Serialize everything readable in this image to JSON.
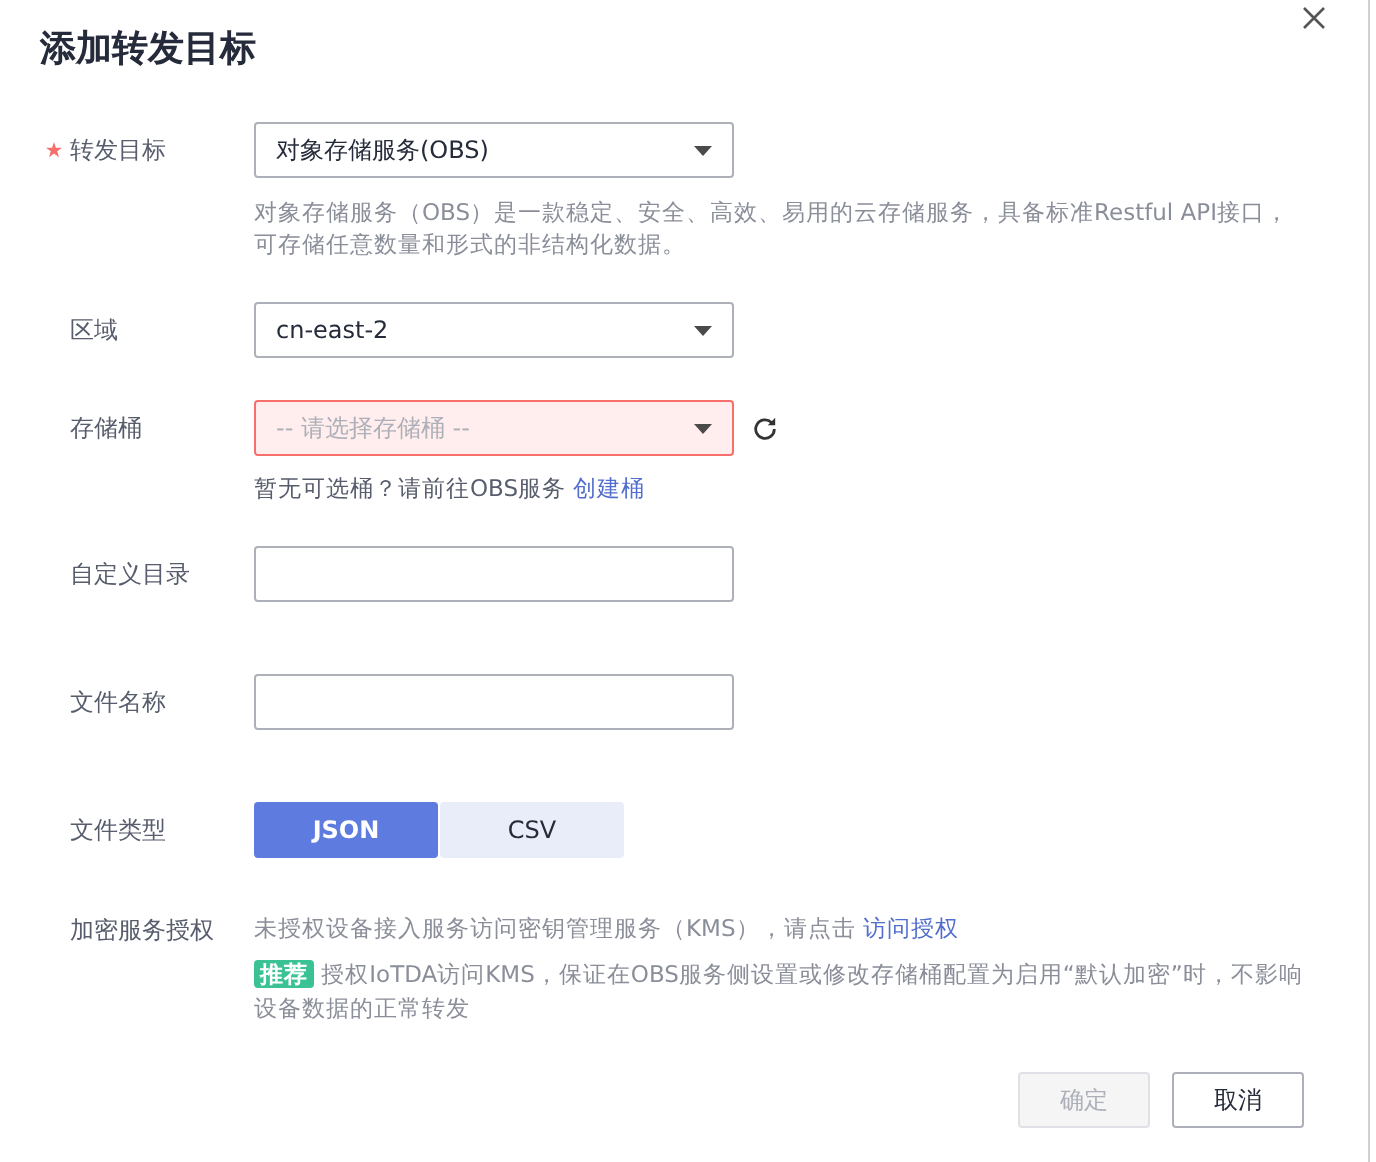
{
  "title": "添加转发目标",
  "fields": [
    {
      "kind": "select",
      "label": "转发目标",
      "required": true,
      "value": "对象存储服务(OBS)",
      "error": false,
      "help": "对象存储服务（OBS）是一款稳定、安全、高效、易用的云存储服务，具备标准Restful API接口，可存储任意数量和形式的非结构化数据。"
    },
    {
      "kind": "select",
      "label": "区域",
      "required": false,
      "value": "cn-east-2",
      "error": false
    },
    {
      "kind": "select",
      "label": "存储桶",
      "required": false,
      "placeholder": "-- 请选择存储桶 --",
      "error": true,
      "refresh": true,
      "hint": "暂无可选桶？请前往OBS服务",
      "hint_link": "创建桶"
    },
    {
      "kind": "input",
      "label": "自定义目录",
      "required": false
    },
    {
      "kind": "input",
      "label": "文件名称",
      "required": false
    },
    {
      "kind": "toggle",
      "label": "文件类型",
      "required": false,
      "options": [
        {
          "label": "JSON",
          "selected": true
        },
        {
          "label": "CSV",
          "selected": false
        }
      ]
    },
    {
      "kind": "auth",
      "label": "加密服务授权",
      "required": false,
      "text": "未授权设备接入服务访问密钥管理服务（KMS），请点击",
      "link": "访问授权",
      "badge": "推荐",
      "note": "授权IoTDA访问KMS，保证在OBS服务侧设置或修改存储桶配置为启用“默认加密”时，不影响设备数据的正常转发"
    }
  ],
  "buttons": [
    {
      "label": "确定",
      "disabled": true
    },
    {
      "label": "取消",
      "disabled": false
    }
  ]
}
